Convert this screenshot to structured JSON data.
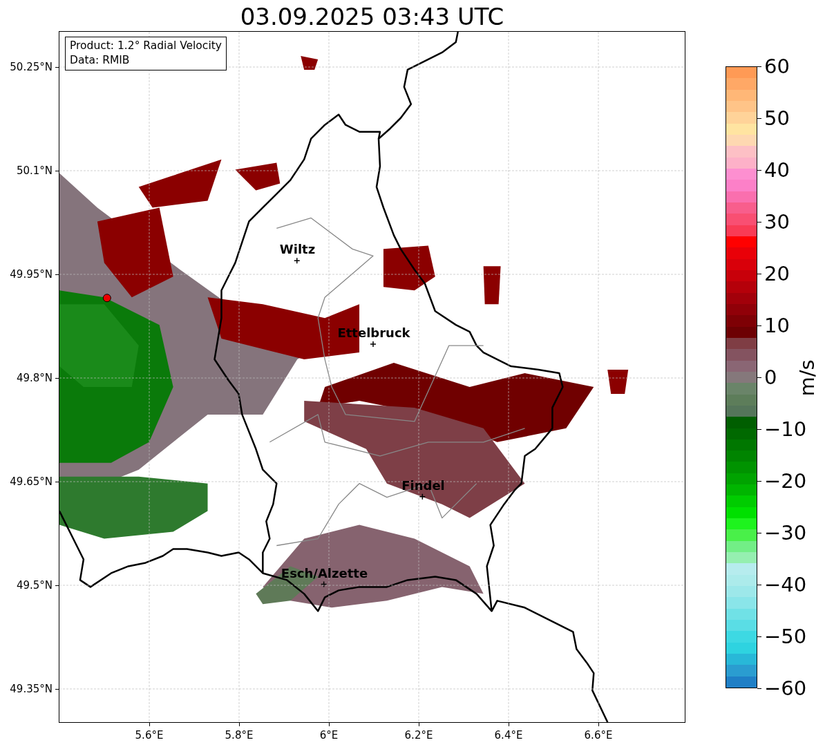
{
  "title": "03.09.2025 03:43 UTC",
  "legend": [
    "Product: 1.2° Radial Velocity",
    "Data: RMIB"
  ],
  "map": {
    "x_ticks": [
      "5.6°E",
      "5.8°E",
      "6°E",
      "6.2°E",
      "6.4°E",
      "6.6°E"
    ],
    "y_ticks": [
      "50.25°N",
      "50.1°N",
      "49.95°N",
      "49.8°N",
      "49.65°N",
      "49.5°N",
      "49.35°N"
    ],
    "places": [
      {
        "name": "Wiltz"
      },
      {
        "name": "Ettelbruck"
      },
      {
        "name": "Findel"
      },
      {
        "name": "Esch/Alzette"
      }
    ]
  },
  "colorbar": {
    "label": "m/s",
    "ticks": [
      "60",
      "50",
      "40",
      "30",
      "20",
      "10",
      "0",
      "−10",
      "−20",
      "−30",
      "−40",
      "−50",
      "−60"
    ]
  }
}
